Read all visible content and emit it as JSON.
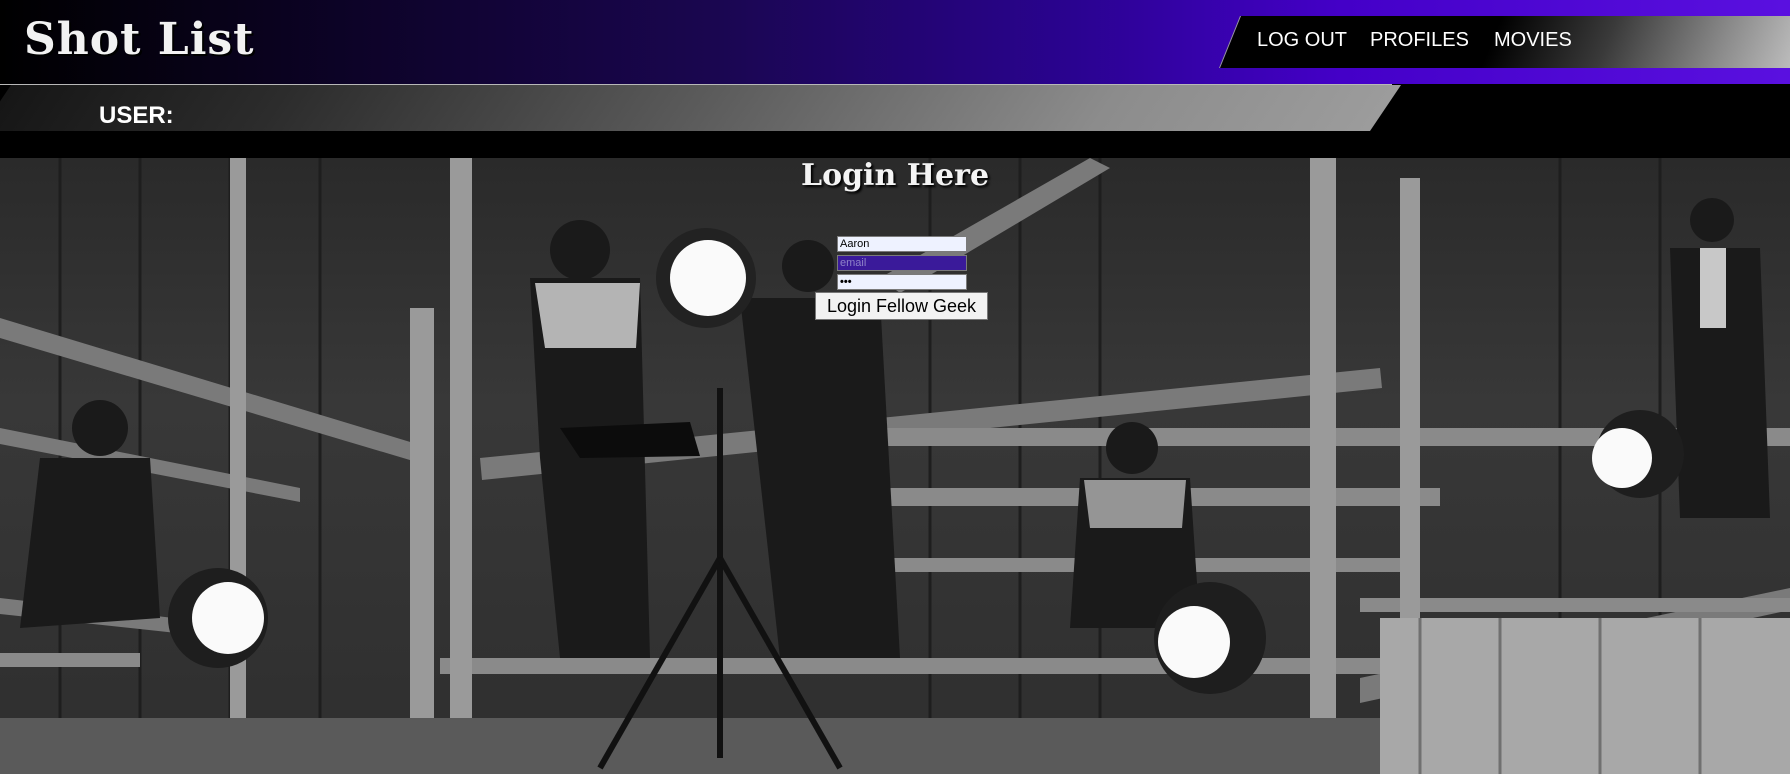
{
  "app": {
    "title": "Shot List"
  },
  "nav": {
    "logout": "LOG OUT",
    "profiles": "PROFILES",
    "movies": "MOVIES"
  },
  "user": {
    "label": "USER:"
  },
  "login": {
    "title": "Login Here",
    "name_value": "Aaron",
    "email_placeholder": "email",
    "password_value": "•••",
    "button_label": "Login Fellow Geek"
  },
  "colors": {
    "header_accent": "#4400c8",
    "email_field_bg": "#3a1a9a"
  }
}
